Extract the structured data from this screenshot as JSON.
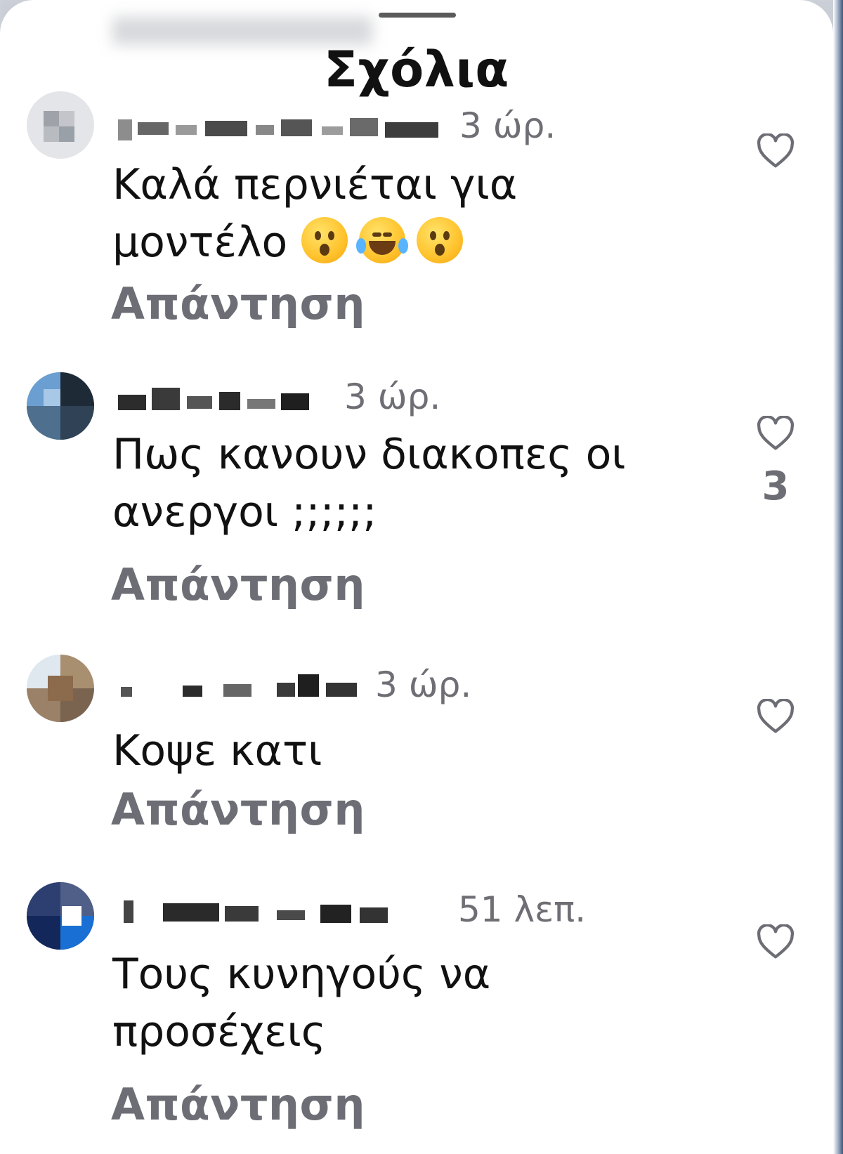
{
  "sheet": {
    "title": "Σχόλια"
  },
  "reply_label": "Απάντηση",
  "comments": [
    {
      "time": "3 ώρ.",
      "text": "Καλά περνιέται για\nμοντέλο",
      "emojis": [
        "astonished-face-emoji",
        "tears-of-joy-emoji",
        "astonished-face-emoji"
      ],
      "like_count": ""
    },
    {
      "time": "3 ώρ.",
      "text": "Πως κανουν διακοπες οι\nανεργοι ;;;;;;",
      "like_count": "3"
    },
    {
      "time": "3 ώρ.",
      "text": "Κοψε κατι",
      "like_count": ""
    },
    {
      "time": "51 λεπ.",
      "text": "Τους κυνηγούς να\nπροσέχεις",
      "like_count": ""
    }
  ],
  "icons": {
    "like": "heart-outline-icon"
  },
  "colors": {
    "secondary_text": "#6d6e75",
    "primary_text": "#111111",
    "background": "#ffffff"
  }
}
